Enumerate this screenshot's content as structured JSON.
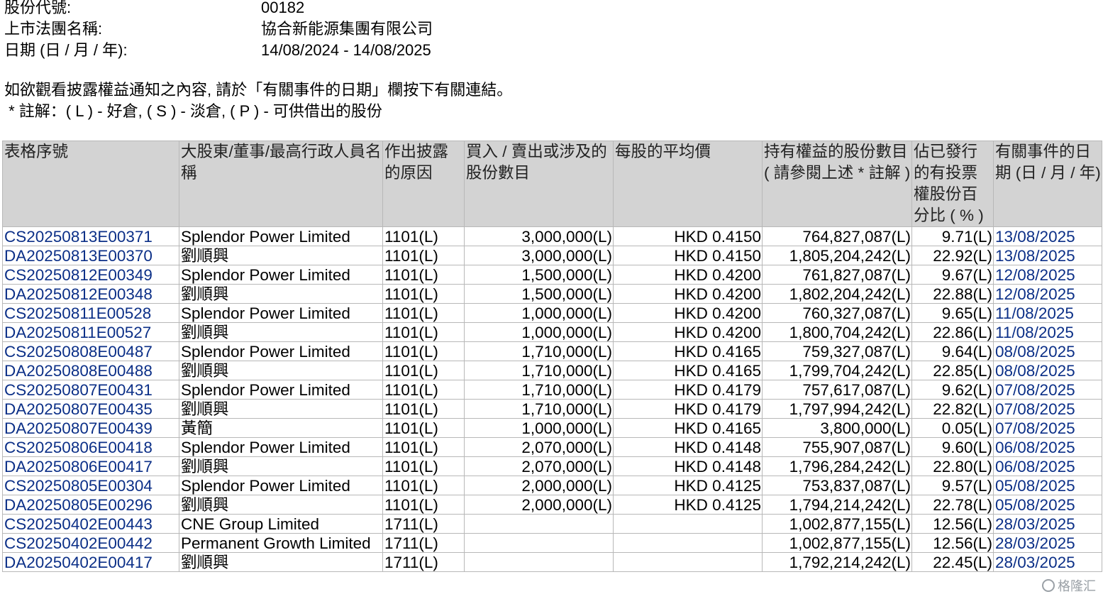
{
  "header": {
    "stock_code_label": "股份代號:",
    "stock_code": "00182",
    "company_label": "上市法團名稱:",
    "company": "協合新能源集團有限公司",
    "date_label": "日期 (日 / 月 / 年):",
    "date_range": "14/08/2024 - 14/08/2025"
  },
  "notes": {
    "line1": "如欲觀看披露權益通知之內容, 請於「有關事件的日期」欄按下有關連結。",
    "line2": " * 註解：( L ) - 好倉, ( S ) - 淡倉, ( P ) - 可供借出的股份"
  },
  "table": {
    "columns": [
      "表格序號",
      "大股東/董事/最高行政人員名稱",
      "作出披露的原因",
      "買入 / 賣出或涉及的股份數目",
      "每股的平均價",
      "持有權益的股份數目 ( 請參閱上述 * 註解 )",
      "佔已發行的有投票權股份百分比 ( % )",
      "有關事件的日期 (日 / 月 / 年)"
    ],
    "rows": [
      {
        "form": "CS20250813E00371",
        "name": "Splendor Power Limited",
        "reason": "1101(L)",
        "shares": "3,000,000(L)",
        "price": "HKD 0.4150",
        "held": "764,827,087(L)",
        "pct": "9.71(L)",
        "date": "13/08/2025"
      },
      {
        "form": "DA20250813E00370",
        "name": "劉順興",
        "reason": "1101(L)",
        "shares": "3,000,000(L)",
        "price": "HKD 0.4150",
        "held": "1,805,204,242(L)",
        "pct": "22.92(L)",
        "date": "13/08/2025"
      },
      {
        "form": "CS20250812E00349",
        "name": "Splendor Power Limited",
        "reason": "1101(L)",
        "shares": "1,500,000(L)",
        "price": "HKD 0.4200",
        "held": "761,827,087(L)",
        "pct": "9.67(L)",
        "date": "12/08/2025"
      },
      {
        "form": "DA20250812E00348",
        "name": "劉順興",
        "reason": "1101(L)",
        "shares": "1,500,000(L)",
        "price": "HKD 0.4200",
        "held": "1,802,204,242(L)",
        "pct": "22.88(L)",
        "date": "12/08/2025"
      },
      {
        "form": "CS20250811E00528",
        "name": "Splendor Power Limited",
        "reason": "1101(L)",
        "shares": "1,000,000(L)",
        "price": "HKD 0.4200",
        "held": "760,327,087(L)",
        "pct": "9.65(L)",
        "date": "11/08/2025"
      },
      {
        "form": "DA20250811E00527",
        "name": "劉順興",
        "reason": "1101(L)",
        "shares": "1,000,000(L)",
        "price": "HKD 0.4200",
        "held": "1,800,704,242(L)",
        "pct": "22.86(L)",
        "date": "11/08/2025"
      },
      {
        "form": "CS20250808E00487",
        "name": "Splendor Power Limited",
        "reason": "1101(L)",
        "shares": "1,710,000(L)",
        "price": "HKD 0.4165",
        "held": "759,327,087(L)",
        "pct": "9.64(L)",
        "date": "08/08/2025"
      },
      {
        "form": "DA20250808E00488",
        "name": "劉順興",
        "reason": "1101(L)",
        "shares": "1,710,000(L)",
        "price": "HKD 0.4165",
        "held": "1,799,704,242(L)",
        "pct": "22.85(L)",
        "date": "08/08/2025"
      },
      {
        "form": "CS20250807E00431",
        "name": "Splendor Power Limited",
        "reason": "1101(L)",
        "shares": "1,710,000(L)",
        "price": "HKD 0.4179",
        "held": "757,617,087(L)",
        "pct": "9.62(L)",
        "date": "07/08/2025"
      },
      {
        "form": "DA20250807E00435",
        "name": "劉順興",
        "reason": "1101(L)",
        "shares": "1,710,000(L)",
        "price": "HKD 0.4179",
        "held": "1,797,994,242(L)",
        "pct": "22.82(L)",
        "date": "07/08/2025"
      },
      {
        "form": "DA20250807E00439",
        "name": "黃簡",
        "reason": "1101(L)",
        "shares": "1,000,000(L)",
        "price": "HKD 0.4165",
        "held": "3,800,000(L)",
        "pct": "0.05(L)",
        "date": "07/08/2025"
      },
      {
        "form": "CS20250806E00418",
        "name": "Splendor Power Limited",
        "reason": "1101(L)",
        "shares": "2,070,000(L)",
        "price": "HKD 0.4148",
        "held": "755,907,087(L)",
        "pct": "9.60(L)",
        "date": "06/08/2025"
      },
      {
        "form": "DA20250806E00417",
        "name": "劉順興",
        "reason": "1101(L)",
        "shares": "2,070,000(L)",
        "price": "HKD 0.4148",
        "held": "1,796,284,242(L)",
        "pct": "22.80(L)",
        "date": "06/08/2025"
      },
      {
        "form": "CS20250805E00304",
        "name": "Splendor Power Limited",
        "reason": "1101(L)",
        "shares": "2,000,000(L)",
        "price": "HKD 0.4125",
        "held": "753,837,087(L)",
        "pct": "9.57(L)",
        "date": "05/08/2025"
      },
      {
        "form": "DA20250805E00296",
        "name": "劉順興",
        "reason": "1101(L)",
        "shares": "2,000,000(L)",
        "price": "HKD 0.4125",
        "held": "1,794,214,242(L)",
        "pct": "22.78(L)",
        "date": "05/08/2025"
      },
      {
        "form": "CS20250402E00443",
        "name": "CNE Group Limited",
        "reason": "1711(L)",
        "shares": "",
        "price": "",
        "held": "1,002,877,155(L)",
        "pct": "12.56(L)",
        "date": "28/03/2025"
      },
      {
        "form": "CS20250402E00442",
        "name": "Permanent Growth Limited",
        "reason": "1711(L)",
        "shares": "",
        "price": "",
        "held": "1,002,877,155(L)",
        "pct": "12.56(L)",
        "date": "28/03/2025"
      },
      {
        "form": "DA20250402E00417",
        "name": "劉順興",
        "reason": "1711(L)",
        "shares": "",
        "price": "",
        "held": "1,792,214,242(L)",
        "pct": "22.45(L)",
        "date": "28/03/2025"
      }
    ]
  },
  "colors": {
    "header_bg": "#d3d3d3",
    "link": "#0b2f87",
    "border": "#b8b8b8"
  },
  "watermark": {
    "text": "格隆汇",
    "icon": "gelonghui-logo-icon"
  }
}
